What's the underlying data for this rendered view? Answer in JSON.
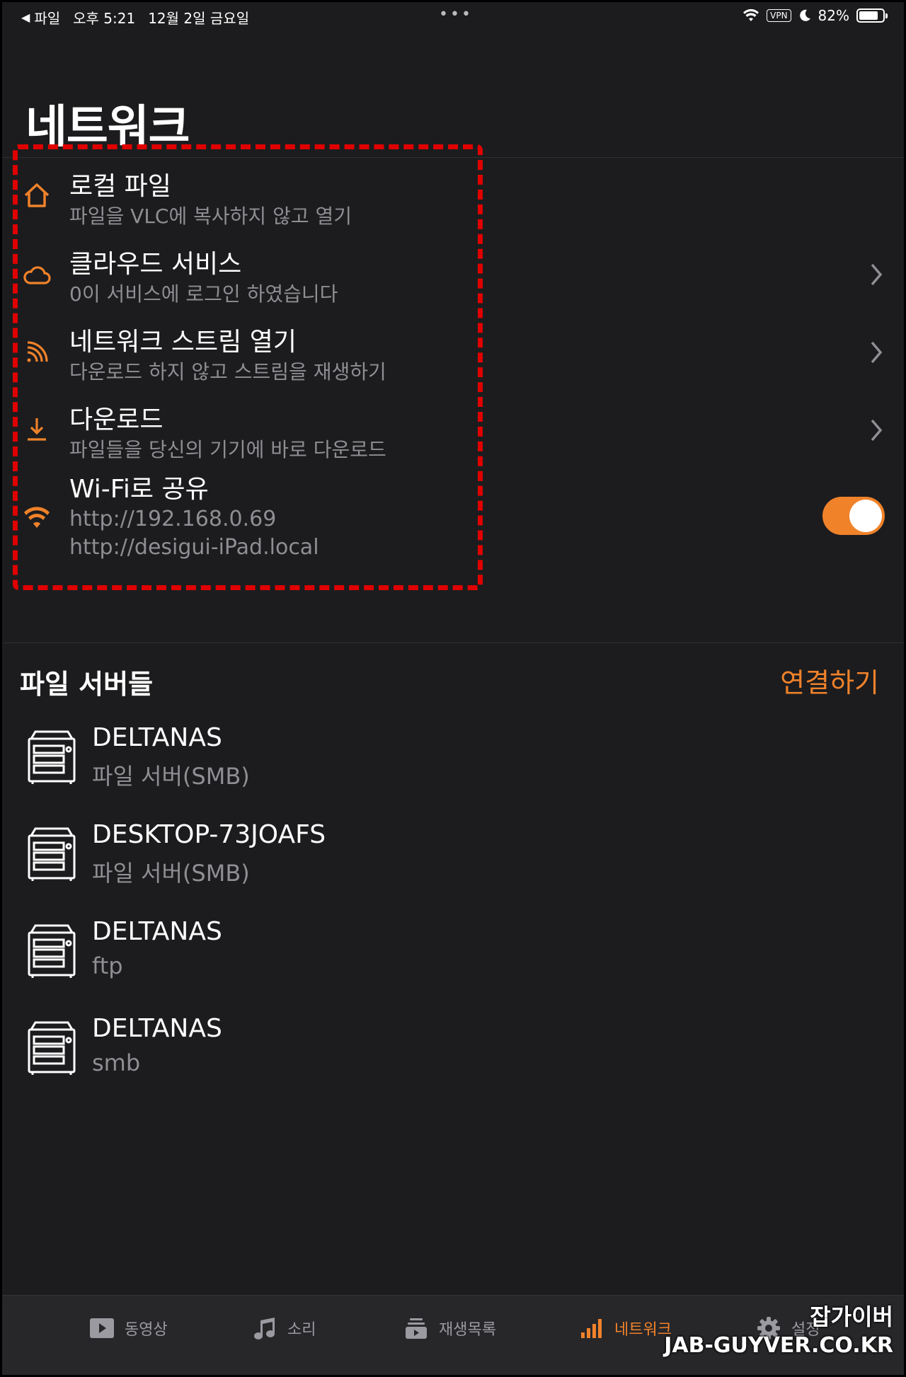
{
  "status_bar": {
    "back_label": "파일",
    "time": "오후 5:21",
    "date": "12월 2일 금요일",
    "vpn": "VPN",
    "battery": "82%",
    "battery_level": 0.82
  },
  "page": {
    "title": "네트워크"
  },
  "menu": [
    {
      "title": "로컬 파일",
      "subtitle": "파일을 VLC에 복사하지 않고 열기",
      "icon": "home-icon"
    },
    {
      "title": "클라우드 서비스",
      "subtitle": "0이 서비스에 로그인 하였습니다",
      "icon": "cloud-icon"
    },
    {
      "title": "네트워크 스트림 열기",
      "subtitle": "다운로드 하지 않고 스트림을 재생하기",
      "icon": "rss-icon"
    },
    {
      "title": "다운로드",
      "subtitle": "파일들을 당신의 기기에 바로 다운로드",
      "icon": "download-icon"
    }
  ],
  "wifi_share": {
    "title": "Wi-Fi로 공유",
    "address_ip": "http://192.168.0.69",
    "address_local": "http://desigui-iPad.local",
    "enabled": true
  },
  "file_servers": {
    "title": "파일 서버들",
    "connect_label": "연결하기",
    "items": [
      {
        "name": "DELTANAS",
        "type": "파일 서버(SMB)"
      },
      {
        "name": "DESKTOP-73JOAFS",
        "type": "파일 서버(SMB)"
      },
      {
        "name": "DELTANAS",
        "type": "ftp"
      },
      {
        "name": "DELTANAS",
        "type": "smb"
      }
    ]
  },
  "tabs": [
    {
      "label": "동영상",
      "icon": "play-icon"
    },
    {
      "label": "소리",
      "icon": "music-icon"
    },
    {
      "label": "재생목록",
      "icon": "playlist-icon"
    },
    {
      "label": "네트워크",
      "icon": "signal-icon",
      "active": true
    },
    {
      "label": "설정",
      "icon": "gear-icon"
    }
  ],
  "watermark": {
    "line1": "잡가이버",
    "line2": "JAB-GUYVER.CO.KR"
  },
  "colors": {
    "accent": "#f0822a",
    "background": "#1c1c1e",
    "highlight": "#e00000"
  }
}
